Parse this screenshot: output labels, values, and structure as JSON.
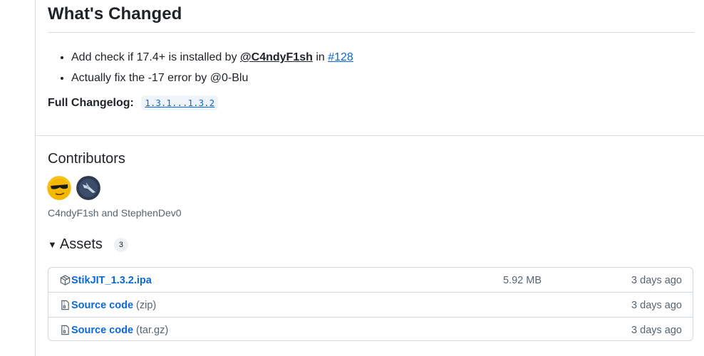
{
  "release": {
    "whats_changed_title": "What's Changed",
    "changes": [
      {
        "prefix": "Add check if 17.4+ is installed by ",
        "author": "@C4ndyF1sh",
        "mid": " in ",
        "pr": "#128"
      },
      {
        "text": "Actually fix the -17 error by @0-Blu"
      }
    ],
    "changelog_label": "Full Changelog:",
    "changelog_range": "1.3.1...1.3.2"
  },
  "contributors": {
    "title": "Contributors",
    "names": "C4ndyF1sh and StephenDev0",
    "avatars": [
      "C4ndyF1sh",
      "StephenDev0"
    ]
  },
  "assets": {
    "title": "Assets",
    "count": "3",
    "rows": [
      {
        "name": "StikJIT_1.3.2.ipa",
        "sub": "",
        "size": "5.92 MB",
        "date": "3 days ago",
        "icon": "package-icon"
      },
      {
        "name": "Source code",
        "sub": "(zip)",
        "size": "",
        "date": "3 days ago",
        "icon": "file-zip-icon"
      },
      {
        "name": "Source code",
        "sub": "(tar.gz)",
        "size": "",
        "date": "3 days ago",
        "icon": "file-zip-icon"
      }
    ]
  },
  "colors": {
    "link": "#0969da",
    "text": "#1f2328",
    "muted": "#59636e",
    "border": "#d0d7de"
  }
}
